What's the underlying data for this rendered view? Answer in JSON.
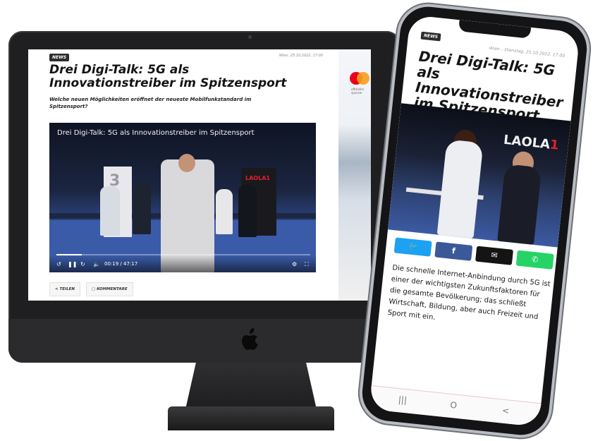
{
  "desktop": {
    "badge": "NEWS",
    "date": "Wien, 25.10.2022, 17:00",
    "title": "Drei Digi-Talk: 5G als Innovationstreiber im Spitzensport",
    "subtitle": "Welche neuen Möglichkeiten eröffnet der neueste Mobilfunkstandard im Spitzensport?",
    "video": {
      "title": "Drei Digi-Talk: 5G als Innovationstreiber im Spitzensport",
      "current_time": "00:19",
      "separator": "/",
      "duration": "47:17",
      "progress_fraction": 0.1,
      "banner_left": "3",
      "banner_right": "LAOLA1"
    },
    "share_label": "TEILEN",
    "comments_label": "KOMMENTARE",
    "ad": {
      "brand_sub": "offizieller sponsor"
    }
  },
  "mobile": {
    "badge": "NEWS",
    "date": "Wien – Dienstag, 25.10.2022, 17:00",
    "title": "Drei Digi-Talk: 5G als Innovationstreiber im Spitzensport",
    "photo_banner": "LAOLA",
    "photo_banner_mark": "1",
    "body": "Die schnelle Internet-Anbindung durch 5G ist einer der wichtigsten Zukunftsfaktoren für die gesamte Bevölkerung; das schließt Wirtschaft, Bildung, aber auch Freizeit und Sport mit ein.",
    "share_facebook": "f",
    "nav": [
      "|||",
      "O",
      "<"
    ]
  }
}
